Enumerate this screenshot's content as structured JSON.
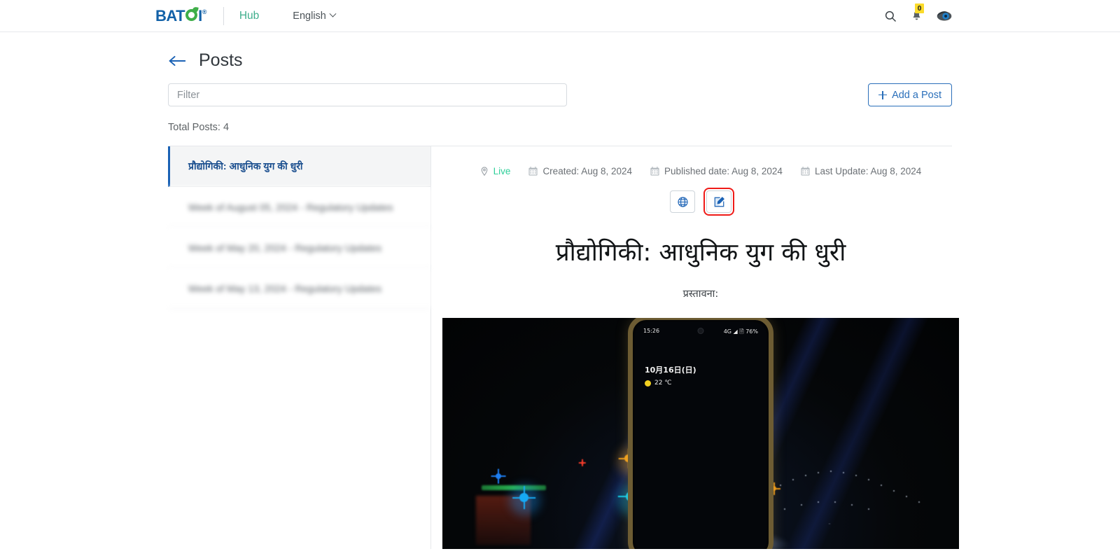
{
  "navbar": {
    "logo_text_1": "BAT",
    "logo_text_2": "I",
    "logo_reg": "®",
    "hub_label": "Hub",
    "language_label": "English",
    "icons": {
      "search": "search-icon",
      "bell": "bell-icon",
      "avatar": "avatar-icon"
    },
    "notification_count": "0"
  },
  "page": {
    "title": "Posts",
    "back_icon": "back-arrow-icon"
  },
  "toolbar": {
    "filter_placeholder": "Filter",
    "filter_value": "",
    "add_post_label": "Add a Post"
  },
  "summary": {
    "total_posts_label": "Total Posts: 4"
  },
  "sidebar": {
    "items": [
      {
        "title": "प्रौद्योगिकी: आधुनिक युग की धुरी",
        "active": true,
        "blurred": false
      },
      {
        "title": "Week of August 05, 2024 - Regulatory Updates",
        "active": false,
        "blurred": true
      },
      {
        "title": "Week of May 20, 2024 - Regulatory Updates",
        "active": false,
        "blurred": true
      },
      {
        "title": "Week of May 13, 2024 - Regulatory Updates",
        "active": false,
        "blurred": true
      }
    ]
  },
  "post": {
    "status_label": "Live",
    "status_color": "#2fcf9a",
    "created_label": "Created: Aug 8, 2024",
    "published_label": "Published date: Aug 8, 2024",
    "last_update_label": "Last Update: Aug 8, 2024",
    "pin_icon": "location-pin-icon",
    "calendar_icon": "calendar-icon",
    "view_button_icon": "globe-icon",
    "edit_button_icon": "edit-pencil-icon",
    "title": "प्रौद्योगिकी: आधुनिक युग की धुरी",
    "subtitle": "प्रस्तावना:"
  },
  "photo": {
    "phone_status_time": "15:26",
    "phone_status_right": "4G ◢ 🗎 76%",
    "phone_lock_date": "10月16日(日)",
    "phone_lock_temp": "22 ℃"
  },
  "annotation": {
    "highlight_color": "#ef1b18",
    "target": "edit-post-button"
  }
}
